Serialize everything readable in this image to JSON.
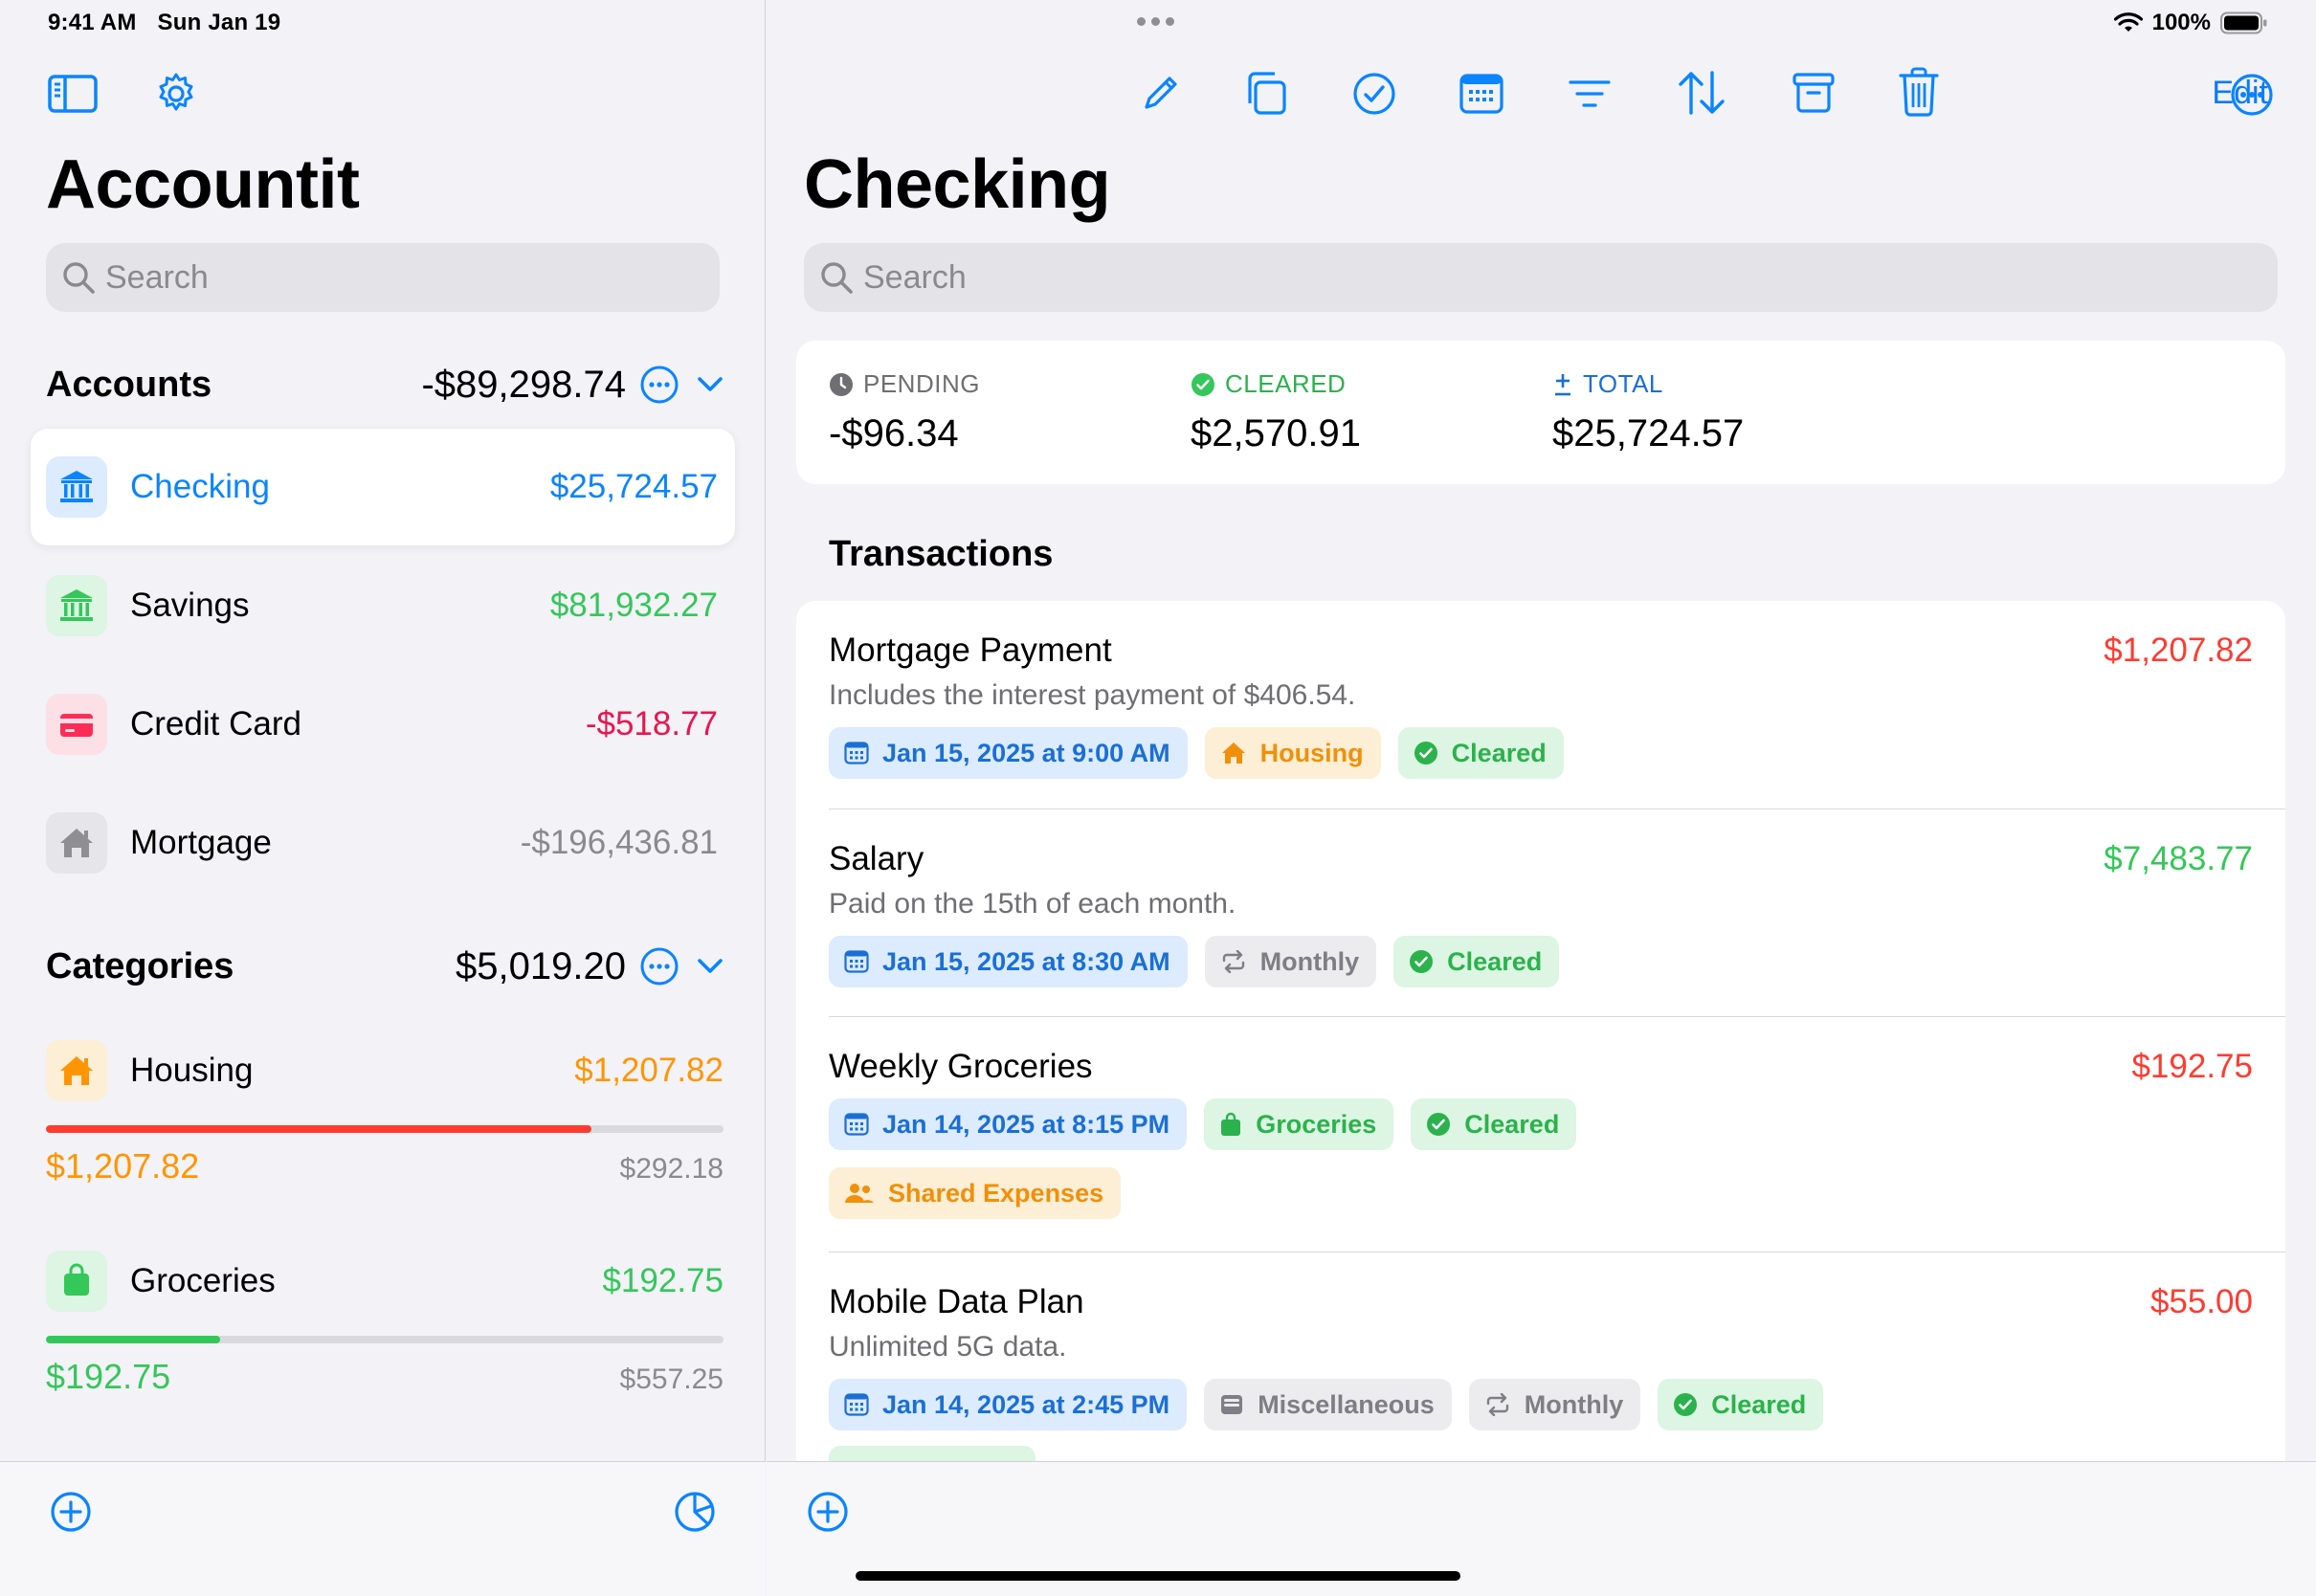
{
  "status": {
    "time": "9:41 AM",
    "date": "Sun Jan 19",
    "battery": "100%"
  },
  "sidebar": {
    "edit_label": "Edit",
    "title": "Accountit",
    "search_placeholder": "Search",
    "accounts": {
      "label": "Accounts",
      "total": "-$89,298.74",
      "items": [
        {
          "name": "Checking",
          "value": "$25,724.57",
          "icon": "bank-icon",
          "color": "#0a84ff",
          "bg": "#dcebfd",
          "selected": true
        },
        {
          "name": "Savings",
          "value": "$81,932.27",
          "icon": "bank-icon",
          "color": "#34c759",
          "bg": "#ddf5e3"
        },
        {
          "name": "Credit Card",
          "value": "-$518.77",
          "icon": "credit-card-icon",
          "color": "#ff2d55",
          "bg": "#fde0e6"
        },
        {
          "name": "Mortgage",
          "value": "-$196,436.81",
          "icon": "house-icon",
          "color": "#8e8e93",
          "bg": "#e5e5ea"
        }
      ]
    },
    "categories": {
      "label": "Categories",
      "total": "$5,019.20",
      "items": [
        {
          "name": "Housing",
          "value": "$1,207.82",
          "spent": "$1,207.82",
          "remaining": "$292.18",
          "progress": 0.805,
          "color": "#ff9500",
          "bar_color": "#ff3b30",
          "icon": "house-icon",
          "bg": "#fdeed6"
        },
        {
          "name": "Groceries",
          "value": "$192.75",
          "spent": "$192.75",
          "remaining": "$557.25",
          "progress": 0.257,
          "color": "#34c759",
          "bar_color": "#34c759",
          "icon": "bag-icon",
          "bg": "#ddf5e3"
        }
      ]
    }
  },
  "detail": {
    "title": "Checking",
    "search_placeholder": "Search",
    "summary": {
      "pending": {
        "label": "PENDING",
        "value": "-$96.34"
      },
      "cleared": {
        "label": "CLEARED",
        "value": "$2,570.91"
      },
      "total": {
        "label": "TOTAL",
        "value": "$25,724.57"
      }
    },
    "transactions_label": "Transactions",
    "transactions": [
      {
        "title": "Mortgage Payment",
        "amount": "$1,207.82",
        "amount_color": "#ff3b30",
        "note": "Includes the interest payment of $406.54.",
        "date": "Jan 15, 2025 at 9:00 AM",
        "chips": [
          {
            "label": "Housing",
            "style": "orange",
            "icon": "house-icon"
          },
          {
            "label": "Cleared",
            "style": "green",
            "icon": "check-circle-icon"
          }
        ]
      },
      {
        "title": "Salary",
        "amount": "$7,483.77",
        "amount_color": "#34c759",
        "note": "Paid on the 15th of each month.",
        "date": "Jan 15, 2025 at 8:30 AM",
        "chips": [
          {
            "label": "Monthly",
            "style": "gray",
            "icon": "repeat-icon"
          },
          {
            "label": "Cleared",
            "style": "green",
            "icon": "check-circle-icon"
          }
        ]
      },
      {
        "title": "Weekly Groceries",
        "amount": "$192.75",
        "amount_color": "#ff3b30",
        "note": "",
        "date": "Jan 14, 2025 at 8:15 PM",
        "chips": [
          {
            "label": "Groceries",
            "style": "green",
            "icon": "bag-icon"
          },
          {
            "label": "Cleared",
            "style": "green",
            "icon": "check-circle-icon"
          }
        ],
        "chips2": [
          {
            "label": "Shared Expenses",
            "style": "orange",
            "icon": "people-icon"
          }
        ]
      },
      {
        "title": "Mobile Data Plan",
        "amount": "$55.00",
        "amount_color": "#ff3b30",
        "note": "Unlimited 5G data.",
        "date": "Jan 14, 2025 at 2:45 PM",
        "chips": [
          {
            "label": "Miscellaneous",
            "style": "gray",
            "icon": "tray-icon"
          },
          {
            "label": "Monthly",
            "style": "gray",
            "icon": "repeat-icon"
          },
          {
            "label": "Cleared",
            "style": "green",
            "icon": "check-circle-icon"
          }
        ]
      }
    ]
  }
}
